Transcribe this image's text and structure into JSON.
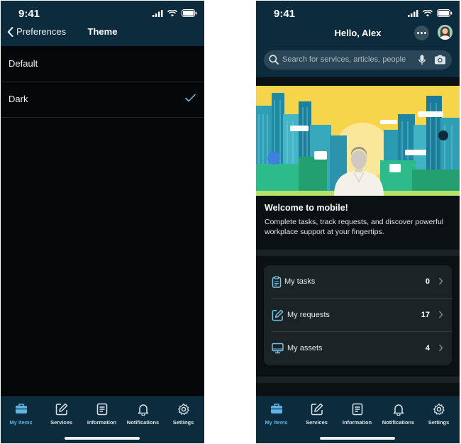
{
  "status": {
    "time": "9:41"
  },
  "theme_screen": {
    "back_label": "Preferences",
    "title": "Theme",
    "options": [
      {
        "label": "Default",
        "selected": false
      },
      {
        "label": "Dark",
        "selected": true
      }
    ]
  },
  "home_screen": {
    "greeting": "Hello, Alex",
    "search_placeholder": "Search for services, articles, people",
    "welcome_title": "Welcome to mobile!",
    "welcome_text": "Complete tasks, track requests, and discover powerful workplace support at your fingertips.",
    "items": [
      {
        "label": "My tasks",
        "count": "0",
        "icon": "clipboard-icon"
      },
      {
        "label": "My requests",
        "count": "17",
        "icon": "edit-icon"
      },
      {
        "label": "My assets",
        "count": "4",
        "icon": "monitor-icon"
      }
    ]
  },
  "tabbar": {
    "tabs": [
      {
        "label": "My items",
        "icon": "briefcase-icon",
        "active": true
      },
      {
        "label": "Services",
        "icon": "edit-icon",
        "active": false
      },
      {
        "label": "Information",
        "icon": "document-icon",
        "active": false
      },
      {
        "label": "Notifications",
        "icon": "bell-icon",
        "active": false
      },
      {
        "label": "Settings",
        "icon": "gear-icon",
        "active": false
      }
    ]
  },
  "colors": {
    "header_bg": "#0c2b3c",
    "accent": "#5fb4e3",
    "check": "#6fb7e6",
    "screen_bg": "#050708"
  }
}
